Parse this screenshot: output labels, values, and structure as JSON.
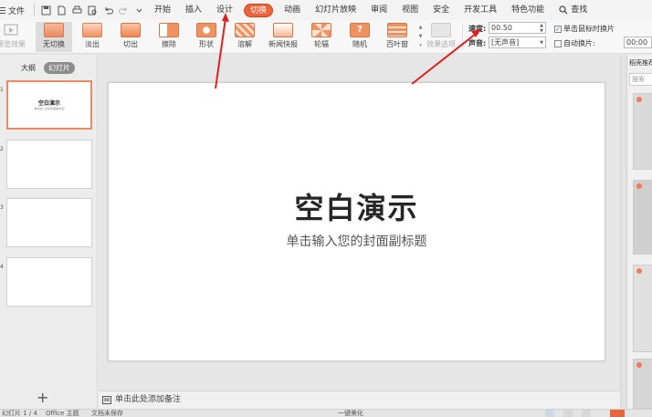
{
  "menu": {
    "file_label": "文件",
    "tabs": [
      "开始",
      "插入",
      "设计",
      "切换",
      "动画",
      "幻灯片放映",
      "审阅",
      "视图",
      "安全",
      "开发工具",
      "特色功能"
    ],
    "active_tab": "切换",
    "search_label": "查找"
  },
  "ribbon": {
    "preview_label": "预览效果",
    "transitions": [
      {
        "label": "无切换",
        "state": "selected"
      },
      {
        "label": "淡出",
        "state": "normal"
      },
      {
        "label": "切出",
        "state": "normal"
      },
      {
        "label": "擦除",
        "state": "normal"
      },
      {
        "label": "形状",
        "state": "normal"
      },
      {
        "label": "溶解",
        "state": "normal"
      },
      {
        "label": "新闻快报",
        "state": "normal"
      },
      {
        "label": "轮辐",
        "state": "normal"
      },
      {
        "label": "随机",
        "state": "normal"
      },
      {
        "label": "百叶窗",
        "state": "normal"
      }
    ],
    "effect_options_label": "效果选项",
    "speed_label": "速度:",
    "speed_value": "00.50",
    "sound_label": "声音:",
    "sound_value": "[无声音]",
    "click_advance_label": "单击鼠标时换片",
    "click_advance_checked": true,
    "auto_advance_label": "自动换片:",
    "auto_advance_checked": false,
    "auto_advance_value": "00:00"
  },
  "left_pane": {
    "tab_outline": "大纲",
    "tab_slides": "幻灯片",
    "slides": [
      {
        "num": "1",
        "title": "空白演示",
        "subtitle": "单击输入您的封面副标题"
      },
      {
        "num": "2",
        "title": "",
        "subtitle": ""
      },
      {
        "num": "3",
        "title": "",
        "subtitle": ""
      },
      {
        "num": "4",
        "title": "",
        "subtitle": ""
      }
    ],
    "add_label": "+"
  },
  "slide": {
    "title": "空白演示",
    "subtitle": "单击输入您的封面副标题"
  },
  "notes": {
    "placeholder": "单击此处添加备注"
  },
  "right_pane": {
    "title": "稻壳推荐",
    "search_placeholder": "搜索"
  },
  "status": {
    "slide_info": "幻灯片 1 / 4",
    "theme": "Office 主题",
    "backup": "文档未保存",
    "beautify": "一键美化"
  },
  "colors": {
    "accent": "#e8643a",
    "annotation_arrow": "#e02020"
  }
}
